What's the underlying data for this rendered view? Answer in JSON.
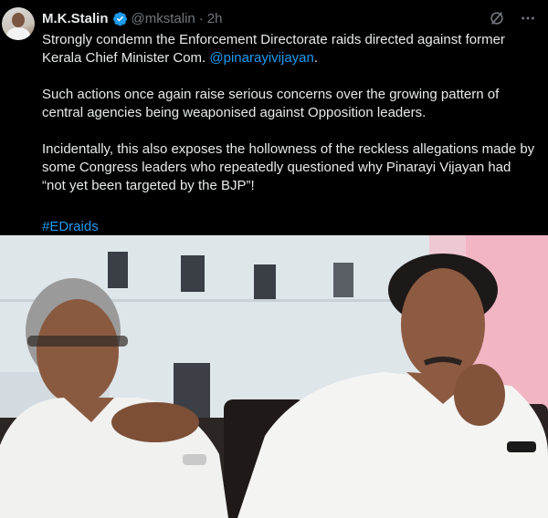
{
  "author": {
    "name": "M.K.Stalin",
    "handle": "@mkstalin",
    "separator": "·",
    "time": "2h"
  },
  "tweet": {
    "paragraph1_a": "Strongly condemn the Enforcement Directorate raids directed against former Kerala Chief Minister Com. ",
    "paragraph1_mention": "@pinarayivijayan",
    "paragraph1_b": ".",
    "paragraph2": "Such actions once again raise serious concerns over the growing pattern of central agencies being weaponised against Opposition leaders.",
    "paragraph3": "Incidentally, this also exposes the hollowness of the reckless allegations made by some Congress leaders who repeatedly questioned why Pinarayi Vijayan had “not yet been targeted by the BJP”!",
    "hashtag": "#EDraids"
  },
  "icons": {
    "verified": "verified-badge-icon",
    "grok": "grok-icon",
    "more": "more-options-icon"
  },
  "colors": {
    "background": "#000000",
    "text": "#e7e9ea",
    "muted": "#71767b",
    "link": "#1d9bf0"
  }
}
